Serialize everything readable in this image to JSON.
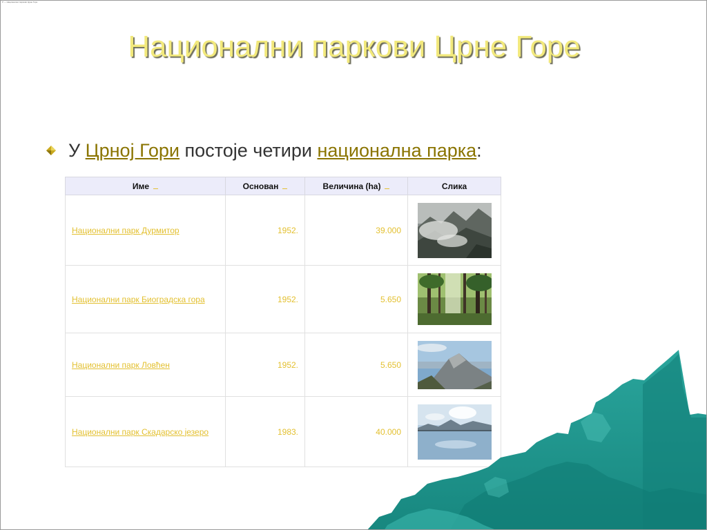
{
  "slide": {
    "title": "Национални паркови Црне Горе",
    "caption": "P — Национални паркови Црне Горе"
  },
  "bullet": {
    "prefix": "У ",
    "link1": "Црној Гори",
    "middle": " постоје четири ",
    "link2": "национална парка",
    "suffix": ":"
  },
  "table": {
    "headers": {
      "name": "Име",
      "founded": "Основан",
      "size": "Величина (ha)",
      "image": "Слика"
    },
    "rows": [
      {
        "name": "Национални парк Дурмитор",
        "founded": "1952.",
        "size": "39.000",
        "image": "durmitor-photo"
      },
      {
        "name": "Национални парк Биоградска гора",
        "founded": "1952.",
        "size": "5.650",
        "image": "biogradska-forest-photo"
      },
      {
        "name": "Национални парк Ловћен",
        "founded": "1952.",
        "size": "5.650",
        "image": "lovcen-mountain-photo"
      },
      {
        "name": "Национални парк Скадарско језеро",
        "founded": "1983.",
        "size": "40.000",
        "image": "skadar-lake-photo"
      }
    ]
  },
  "colors": {
    "title": "#f2e97c",
    "link": "#e3c030",
    "header_bg": "#ececfa",
    "teal": "#1f9b92"
  }
}
